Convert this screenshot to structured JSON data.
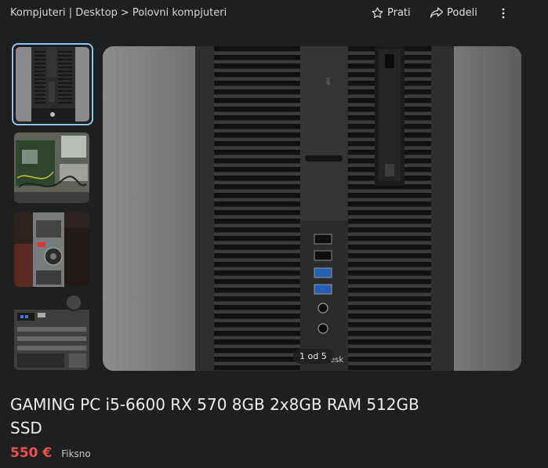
{
  "breadcrumb": {
    "category": "Kompjuteri | Desktop",
    "separator": ">",
    "subcategory": "Polovni kompjuteri"
  },
  "actions": {
    "follow_label": "Prati",
    "share_label": "Podeli",
    "follow_icon": "star-outline-icon",
    "share_icon": "share-arrow-icon",
    "more_icon": "vertical-dots-icon"
  },
  "gallery": {
    "counter": "1 od 5",
    "thumbnails": [
      {
        "subject": "pc-front"
      },
      {
        "subject": "pc-interior"
      },
      {
        "subject": "pc-rear"
      },
      {
        "subject": "pc-ports"
      }
    ],
    "active_index": 0
  },
  "listing": {
    "title": "GAMING PC i5-6600 RX 570 8GB 2x8GB RAM 512GB SSD",
    "price": "550 €",
    "price_type": "Fiksno"
  },
  "colors": {
    "background": "#1e1f21",
    "price": "#e9524f",
    "active_thumb_border": "#8fc3e6"
  }
}
